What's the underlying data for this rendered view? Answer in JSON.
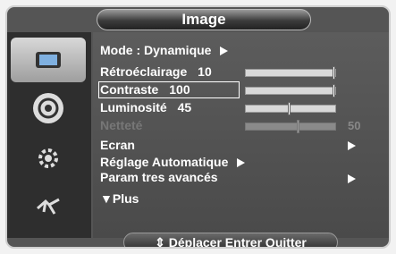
{
  "title": "Image",
  "menu": {
    "mode": {
      "label": "Mode : Dynamique"
    },
    "retroeclairage": {
      "label": "Rétroéclairage",
      "value": "10",
      "level": 1.0
    },
    "contraste": {
      "label": "Contraste",
      "value": "100",
      "level": 1.0
    },
    "luminosite": {
      "label": "Luminosité",
      "value": "45",
      "level": 0.5
    },
    "nettete": {
      "label": "Netteté",
      "value": "50",
      "level": 0.6
    },
    "ecran": {
      "label": "Ecran"
    },
    "reglage_auto": {
      "label": "Réglage Automatique"
    },
    "params": {
      "label": "Param  tres avancés"
    },
    "plus": {
      "label": "▼Plus"
    }
  },
  "footer": {
    "text": "⇕ Déplacer  Entrer  Quitter"
  },
  "sidebar": {
    "items": [
      "picture-icon",
      "sound-icon",
      "settings-icon",
      "input-icon"
    ]
  }
}
